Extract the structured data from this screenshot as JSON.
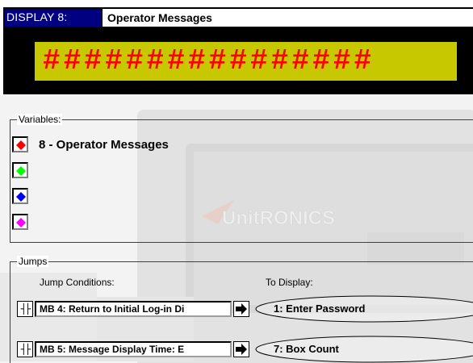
{
  "title": {
    "label": "DISPLAY 8:",
    "name": "Operator Messages"
  },
  "lcd": {
    "text": "################",
    "background_color": "#c8c800",
    "text_color": "#ff0000"
  },
  "variables": {
    "group_title": "Variables:",
    "items": [
      {
        "color": "#ff0000",
        "icon": "red-diamond-icon",
        "label": "8 - Operator Messages"
      },
      {
        "color": "#00ff00",
        "icon": "green-diamond-icon",
        "label": ""
      },
      {
        "color": "#0000ff",
        "icon": "blue-diamond-icon",
        "label": ""
      },
      {
        "color": "#ff00ff",
        "icon": "magenta-diamond-icon",
        "label": ""
      }
    ]
  },
  "jumps": {
    "group_title": "Jumps",
    "conditions_header": "Jump Conditions:",
    "to_display_header": "To Display:",
    "rows": [
      {
        "condition": "MB  4: Return to Initial Log-in Di",
        "target": "1: Enter Password"
      },
      {
        "condition": "MB  5: Message Display Time: E",
        "target": "7: Box Count"
      }
    ]
  },
  "background": {
    "brand": "UnitRONICS"
  }
}
